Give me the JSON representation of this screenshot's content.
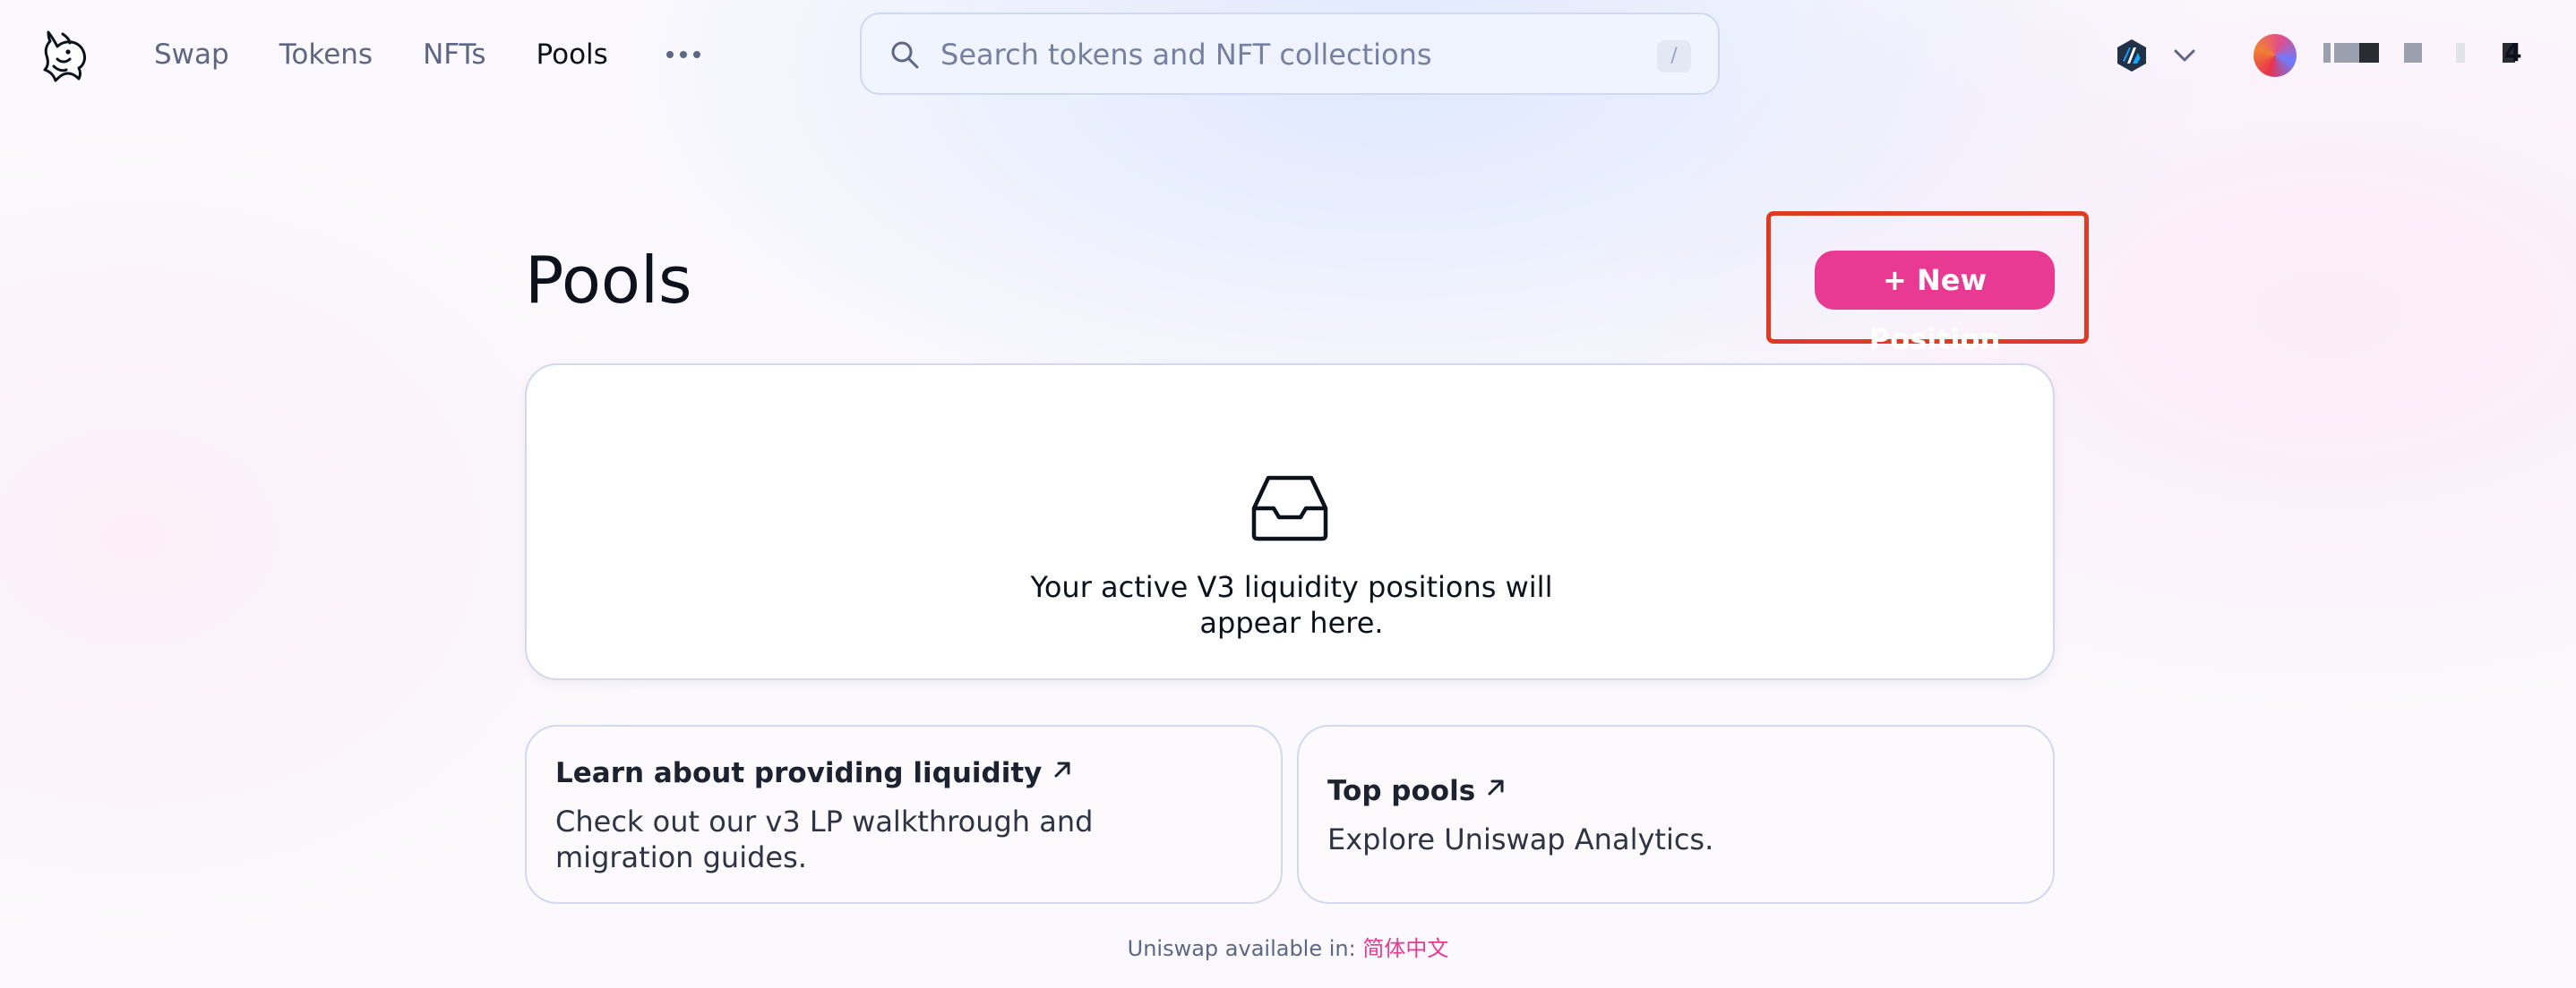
{
  "nav": {
    "links": [
      {
        "label": "Swap",
        "active": false
      },
      {
        "label": "Tokens",
        "active": false
      },
      {
        "label": "NFTs",
        "active": false
      },
      {
        "label": "Pools",
        "active": true
      }
    ],
    "more_icon": "ellipsis-icon"
  },
  "search": {
    "placeholder": "Search tokens and NFT collections",
    "shortcut": "/"
  },
  "network": {
    "icon": "arbitrum-icon"
  },
  "account": {
    "icon": "wallet-avatar",
    "suffix": "4"
  },
  "main": {
    "title": "Pools",
    "new_position_label": "+ New Position",
    "empty_state": {
      "icon": "inbox-icon",
      "line1": "Your active V3 liquidity positions will",
      "line2": "appear here."
    },
    "cards": [
      {
        "title": "Learn about providing liquidity",
        "description": "Check out our v3 LP walkthrough and migration guides."
      },
      {
        "title": "Top pools",
        "description": "Explore Uniswap Analytics."
      }
    ]
  },
  "footer": {
    "text": "Uniswap available in:",
    "language": "简体中文"
  },
  "colors": {
    "accent": "#e83a93",
    "highlight_border": "#e03a22",
    "text_primary": "#0d111c",
    "text_secondary": "#5d6785"
  }
}
